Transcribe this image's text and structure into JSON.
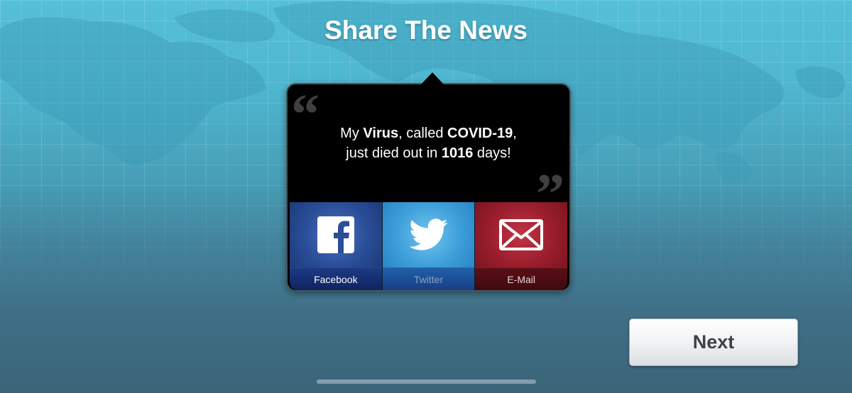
{
  "screen": {
    "title": "Share The News"
  },
  "share_card": {
    "quote_open": "“",
    "quote_close": "”",
    "message_line1": {
      "prefix": "My",
      "virus_word": "Virus",
      "middle": ", called",
      "disease_name": "COVID-19",
      "suffix": ","
    },
    "message_line2": {
      "prefix": "just died out in",
      "days_count": "1016",
      "suffix": "days!"
    },
    "buttons": [
      {
        "label": "Facebook",
        "icon": "facebook-icon",
        "color": "#2a4e98"
      },
      {
        "label": "Twitter",
        "icon": "twitter-bird-icon",
        "color": "#3ea0da"
      },
      {
        "label": "E-Mail",
        "icon": "envelope-icon",
        "color": "#9b1e2c"
      }
    ]
  },
  "next_button": {
    "label": "Next"
  },
  "colors": {
    "background_top": "#56c0d8",
    "background_bottom": "#3c6479",
    "panel": "#000000"
  }
}
